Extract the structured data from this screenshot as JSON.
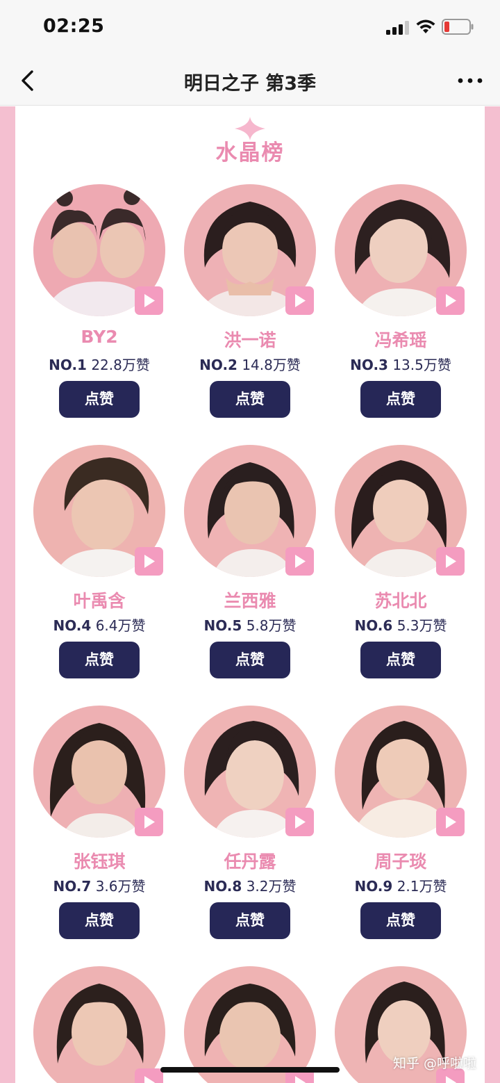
{
  "status": {
    "time": "02:25"
  },
  "nav": {
    "title": "明日之子 第3季"
  },
  "section": {
    "title": "水晶榜"
  },
  "like_label": "点赞",
  "watermark": "知乎 @呼啦啦",
  "colors": {
    "accent_pink": "#ea8bb0",
    "button_navy": "#262757",
    "border_pink": "#f4bfd0"
  },
  "contestants": [
    {
      "name": "BY2",
      "rank": "NO.1",
      "likes": "22.8万赞"
    },
    {
      "name": "洪一诺",
      "rank": "NO.2",
      "likes": "14.8万赞"
    },
    {
      "name": "冯希瑶",
      "rank": "NO.3",
      "likes": "13.5万赞"
    },
    {
      "name": "叶禹含",
      "rank": "NO.4",
      "likes": "6.4万赞"
    },
    {
      "name": "兰西雅",
      "rank": "NO.5",
      "likes": "5.8万赞"
    },
    {
      "name": "苏北北",
      "rank": "NO.6",
      "likes": "5.3万赞"
    },
    {
      "name": "张钰琪",
      "rank": "NO.7",
      "likes": "3.6万赞"
    },
    {
      "name": "任丹露",
      "rank": "NO.8",
      "likes": "3.2万赞"
    },
    {
      "name": "周子琰",
      "rank": "NO.9",
      "likes": "2.1万赞"
    }
  ]
}
